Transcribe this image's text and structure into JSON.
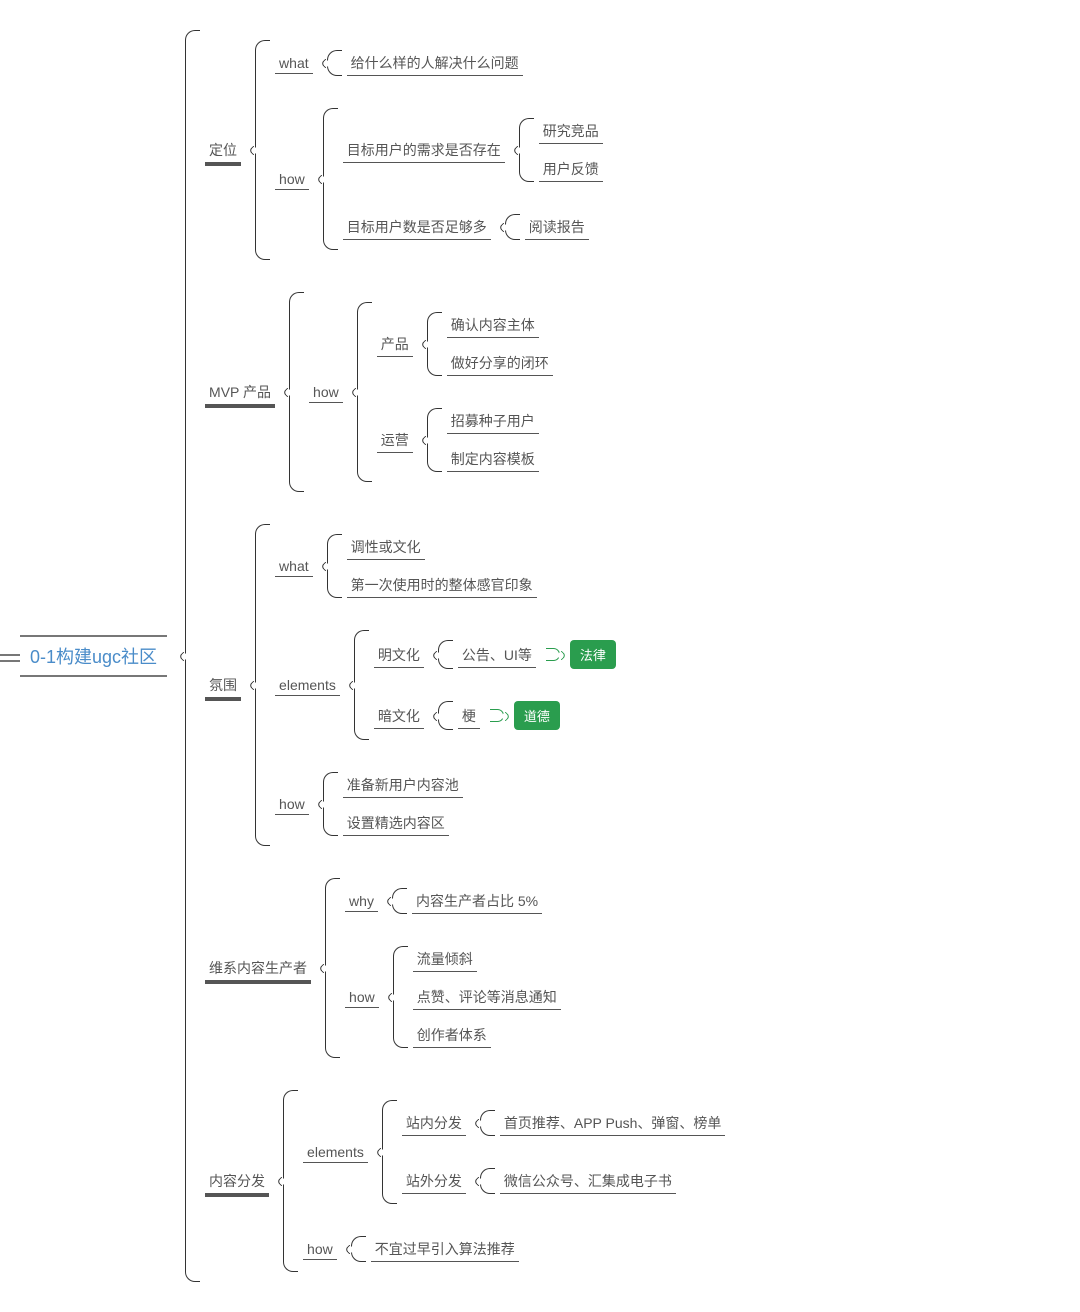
{
  "root": "0-1构建ugc社区",
  "branches": {
    "positioning": {
      "label": "定位",
      "what": {
        "label": "what",
        "items": [
          "给什么样的人解决什么问题"
        ]
      },
      "how": {
        "label": "how",
        "needExist": {
          "label": "目标用户的需求是否存在",
          "items": [
            "研究竞品",
            "用户反馈"
          ]
        },
        "needEnough": {
          "label": "目标用户数是否足够多",
          "items": [
            "阅读报告"
          ]
        }
      }
    },
    "mvp": {
      "label": "MVP 产品",
      "how": {
        "label": "how",
        "product": {
          "label": "产品",
          "items": [
            "确认内容主体",
            "做好分享的闭环"
          ]
        },
        "operation": {
          "label": "运营",
          "items": [
            "招募种子用户",
            "制定内容模板"
          ]
        }
      }
    },
    "atmosphere": {
      "label": "氛围",
      "what": {
        "label": "what",
        "items": [
          "调性或文化",
          "第一次使用时的整体感官印象"
        ]
      },
      "elements": {
        "label": "elements",
        "mingCulture": {
          "label": "明文化",
          "items": [
            "公告、UI等"
          ],
          "tag": "法律"
        },
        "anCulture": {
          "label": "暗文化",
          "items": [
            "梗"
          ],
          "tag": "道德"
        }
      },
      "how": {
        "label": "how",
        "items": [
          "准备新用户内容池",
          "设置精选内容区"
        ]
      }
    },
    "producers": {
      "label": "维系内容生产者",
      "why": {
        "label": "why",
        "items": [
          "内容生产者占比 5%"
        ]
      },
      "how": {
        "label": "how",
        "items": [
          "流量倾斜",
          "点赞、评论等消息通知",
          "创作者体系"
        ]
      }
    },
    "distribution": {
      "label": "内容分发",
      "elements": {
        "label": "elements",
        "inSite": {
          "label": "站内分发",
          "items": [
            "首页推荐、APP Push、弹窗、榜单"
          ]
        },
        "outSite": {
          "label": "站外分发",
          "items": [
            "微信公众号、汇集成电子书"
          ]
        }
      },
      "how": {
        "label": "how",
        "items": [
          "不宜过早引入算法推荐"
        ]
      }
    }
  }
}
